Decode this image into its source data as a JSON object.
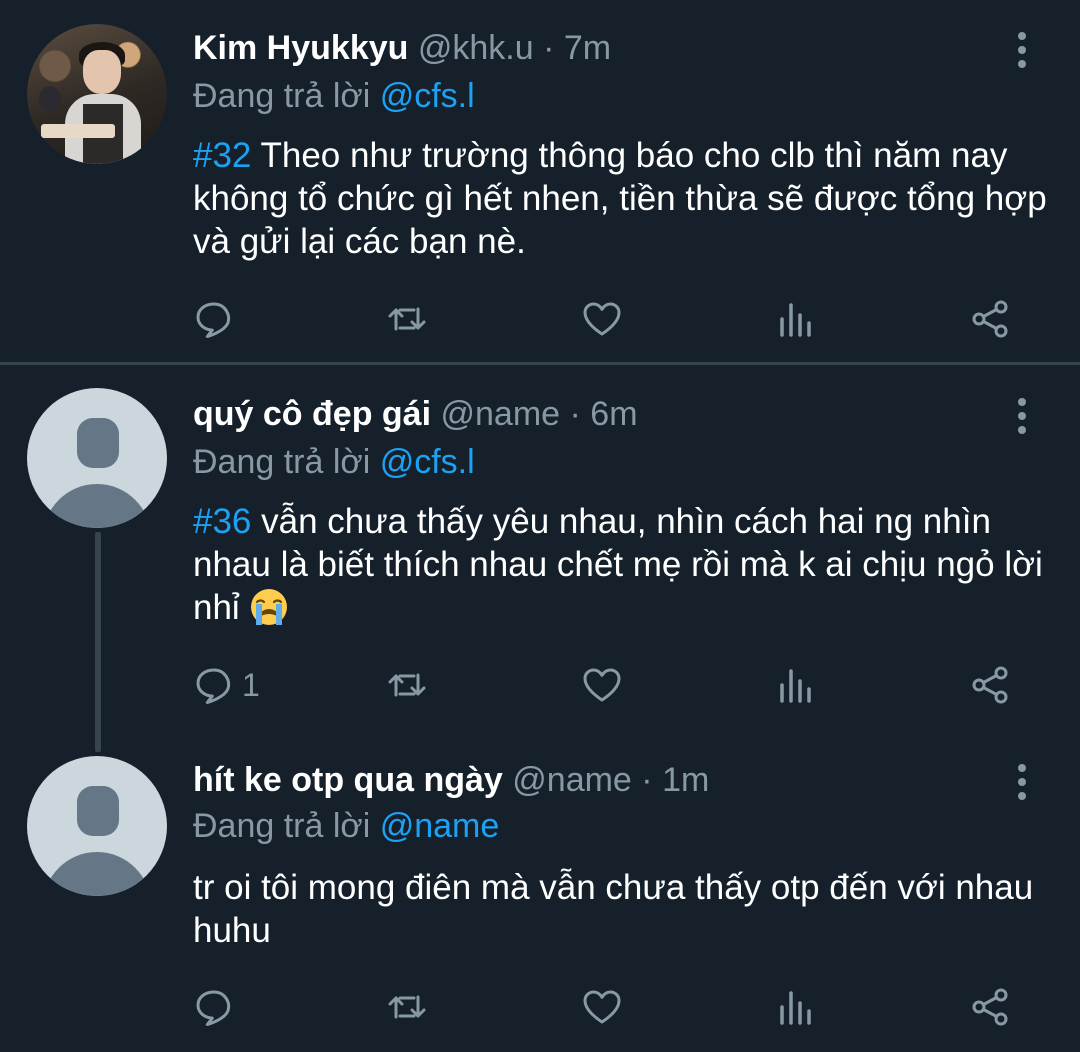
{
  "tweets": [
    {
      "name": "Kim Hyukkyu",
      "handle": "@khk.u",
      "time": "7m",
      "replying_label": "Đang trả lời",
      "replying_to": "@cfs.l",
      "hashtag": "#32",
      "text": " Theo như trường thông báo cho clb thì năm nay không tổ chức gì hết nhen, tiền thừa sẽ được tổng hợp và gửi lại các bạn nè.",
      "reply_count": ""
    },
    {
      "name": "quý cô đẹp gái",
      "handle": "@name",
      "time": "6m",
      "replying_label": "Đang trả lời",
      "replying_to": "@cfs.l",
      "hashtag": "#36",
      "text": " vẫn chưa thấy yêu nhau, nhìn cách hai ng nhìn nhau là biết thích nhau chết mẹ rồi mà k ai chịu ngỏ lời nhỉ ",
      "emoji": "loudly-crying-face",
      "reply_count": "1"
    },
    {
      "name": "hít ke otp qua ngày",
      "handle": "@name",
      "time": "1m",
      "replying_label": "Đang trả lời",
      "replying_to": "@name",
      "hashtag": "",
      "text": "tr oi tôi mong điên mà vẫn chưa thấy otp đến với nhau huhu",
      "reply_count": ""
    }
  ],
  "separator": " · ",
  "icons": {
    "reply": "speech-bubble-icon",
    "retweet": "retweet-icon",
    "like": "heart-icon",
    "stats": "bar-chart-icon",
    "share": "share-icon",
    "more": "vertical-dots-icon"
  },
  "colors": {
    "background": "#15202b",
    "text": "#ffffff",
    "muted": "#8899a6",
    "accent": "#1da1f2",
    "divider": "#38444d"
  }
}
